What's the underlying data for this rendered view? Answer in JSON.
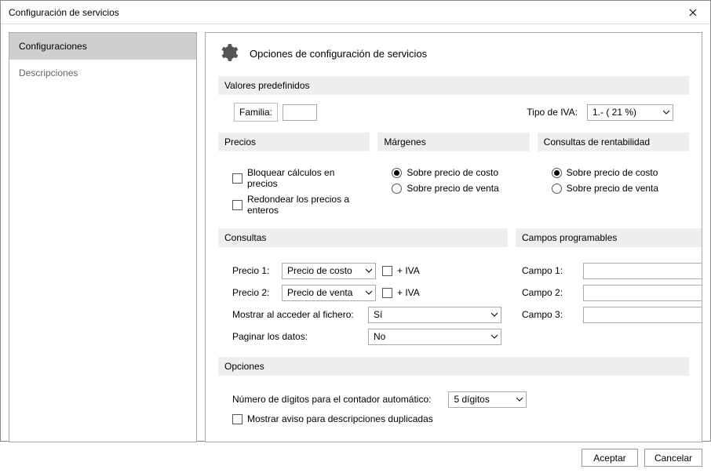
{
  "window": {
    "title": "Configuración de servicios"
  },
  "sidebar": {
    "items": [
      {
        "label": "Configuraciones",
        "selected": true
      },
      {
        "label": "Descripciones",
        "selected": false
      }
    ]
  },
  "content": {
    "title": "Opciones de configuración de servicios",
    "sections": {
      "valores": {
        "title": "Valores predefinidos",
        "familia_label": "Familia:",
        "familia_value": "",
        "iva_label": "Tipo de IVA:",
        "iva_value": "1.- ( 21 %)"
      },
      "precios": {
        "title": "Precios",
        "bloquear": "Bloquear cálculos en precios",
        "redondear": "Redondear los precios a enteros"
      },
      "margenes": {
        "title": "Márgenes",
        "costo": "Sobre precio de costo",
        "venta": "Sobre precio de venta"
      },
      "rentabilidad": {
        "title": "Consultas de rentabilidad",
        "costo": "Sobre precio de costo",
        "venta": "Sobre precio de venta"
      },
      "consultas": {
        "title": "Consultas",
        "precio1_label": "Precio 1:",
        "precio1_value": "Precio de costo",
        "precio2_label": "Precio 2:",
        "precio2_value": "Precio de venta",
        "iva_suffix": "+ IVA",
        "mostrar_label": "Mostrar al acceder al fichero:",
        "mostrar_value": "Sí",
        "paginar_label": "Paginar los datos:",
        "paginar_value": "No"
      },
      "campos": {
        "title": "Campos programables",
        "c1_label": "Campo 1:",
        "c1_value": "",
        "c2_label": "Campo 2:",
        "c2_value": "",
        "c3_label": "Campo 3:",
        "c3_value": ""
      },
      "opciones": {
        "title": "Opciones",
        "digitos_label": "Número de dígitos para el contador automático:",
        "digitos_value": "5 dígitos",
        "aviso": "Mostrar aviso para descripciones duplicadas"
      }
    }
  },
  "buttons": {
    "accept": "Aceptar",
    "cancel": "Cancelar"
  }
}
